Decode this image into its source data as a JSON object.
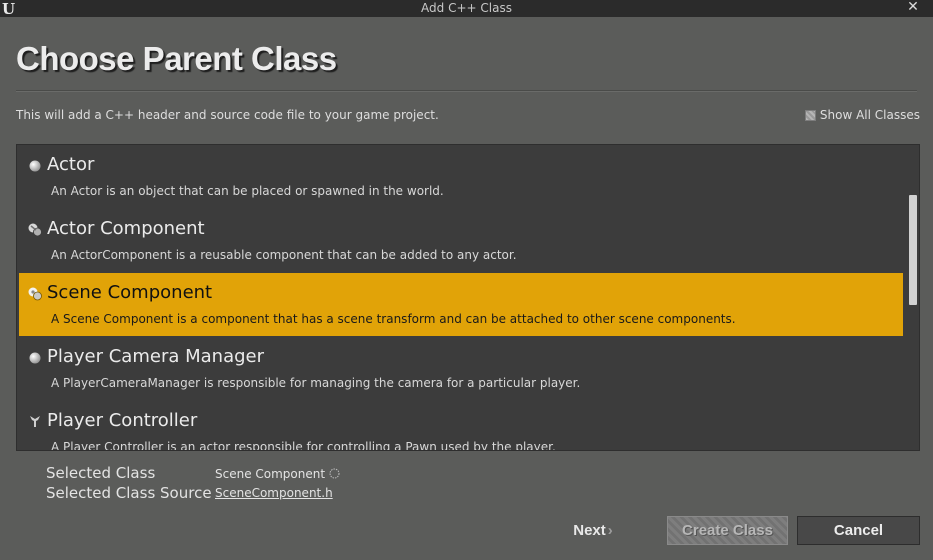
{
  "window": {
    "title": "Add C++ Class",
    "close_glyph": "✕",
    "logo_text": "U"
  },
  "header": {
    "title": "Choose Parent Class",
    "description": "This will add a C++ header and source code file to your game project.",
    "show_all_label": "Show All Classes"
  },
  "classes": [
    {
      "name": "Actor",
      "description": "An Actor is an object that can be placed or spawned in the world.",
      "icon": "actor-icon"
    },
    {
      "name": "Actor Component",
      "description": "An ActorComponent is a reusable component that can be added to any actor.",
      "icon": "actor-component-icon"
    },
    {
      "name": "Scene Component",
      "description": "A Scene Component is a component that has a scene transform and can be attached to other scene components.",
      "icon": "scene-component-icon",
      "selected": true
    },
    {
      "name": "Player Camera Manager",
      "description": "A PlayerCameraManager is responsible for managing the camera for a particular player.",
      "icon": "player-camera-manager-icon"
    },
    {
      "name": "Player Controller",
      "description": "A Player Controller is an actor responsible for controlling a Pawn used by the player.",
      "icon": "player-controller-icon"
    }
  ],
  "selection": {
    "class_label": "Selected Class",
    "class_value": "Scene Component",
    "source_label": "Selected Class Source",
    "source_value": "SceneComponent.h"
  },
  "buttons": {
    "next": "Next",
    "next_glyph": "›",
    "create": "Create Class",
    "cancel": "Cancel"
  },
  "colors": {
    "selected_row": "#e1a308",
    "background": "#5b5c5a",
    "list_background": "#3c3c3c"
  }
}
